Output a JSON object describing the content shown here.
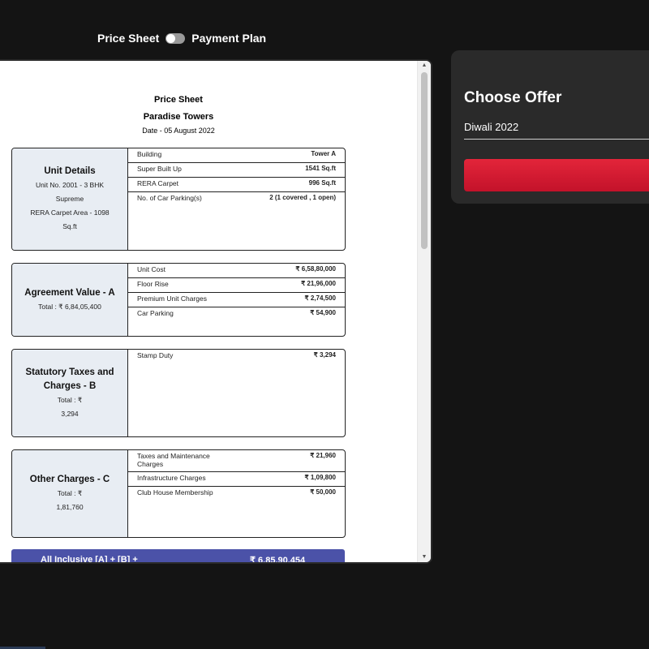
{
  "toggle": {
    "left_label": "Price Sheet",
    "right_label": "Payment Plan"
  },
  "document": {
    "title": "Price Sheet",
    "project": "Paradise Towers",
    "date": "Date - 05 August 2022",
    "sections": [
      {
        "title": "Unit Details",
        "sub": [
          "Unit No. 2001 - 3 BHK",
          "Supreme",
          "RERA Carpet Area - 1098",
          "Sq.ft"
        ],
        "rows": [
          {
            "label": "Building",
            "value": "Tower A"
          },
          {
            "label": "Super Built Up",
            "value": "1541 Sq.ft"
          },
          {
            "label": "RERA Carpet",
            "value": "996 Sq.ft"
          },
          {
            "label": "No. of Car Parking(s)",
            "value": "2 (1 covered , 1 open)"
          }
        ]
      },
      {
        "title": "Agreement Value - A",
        "sub": [
          "Total : ₹ 6,84,05,400"
        ],
        "rows": [
          {
            "label": "Unit Cost",
            "value": "₹ 6,58,80,000"
          },
          {
            "label": "Floor Rise",
            "value": "₹ 21,96,000"
          },
          {
            "label": "Premium Unit Charges",
            "value": "₹ 2,74,500"
          },
          {
            "label": "Car Parking",
            "value": "₹ 54,900"
          }
        ]
      },
      {
        "title": "Statutory Taxes and Charges - B",
        "sub": [
          "Total : ₹",
          "3,294"
        ],
        "rows": [
          {
            "label": "Stamp Duty",
            "value": "₹ 3,294"
          }
        ]
      },
      {
        "title": "Other Charges - C",
        "sub": [
          "Total : ₹",
          "1,81,760"
        ],
        "rows": [
          {
            "label": "Taxes and Maintenance Charges",
            "value": "₹ 21,960"
          },
          {
            "label": "Infrastructure Charges",
            "value": "₹ 1,09,800"
          },
          {
            "label": "Club House Membership",
            "value": "₹ 50,000"
          }
        ]
      }
    ],
    "total_label": "All Inclusive [A] + [B] +",
    "total_value": "₹ 6,85,90,454"
  },
  "offer": {
    "title": "Choose Offer",
    "selected": "Diwali 2022"
  },
  "colors": {
    "accent_red": "#d61f33",
    "total_bar": "#4b52a8",
    "panel_bg": "#2a2a2a"
  }
}
